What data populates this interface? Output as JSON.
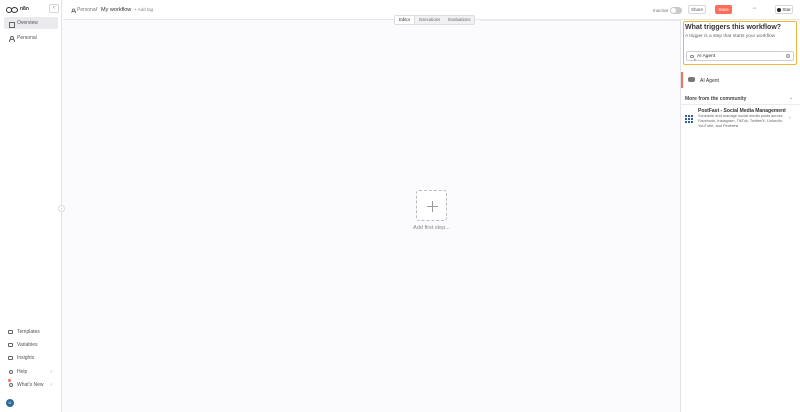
{
  "app": {
    "logo_text": "n8n"
  },
  "sidebar": {
    "overview_label": "Overview",
    "personal_label": "Personal",
    "templates_label": "Templates",
    "variables_label": "Variables",
    "insights_label": "Insights",
    "help_label": "Help",
    "whats_new_label": "What's New",
    "user_initials": "U"
  },
  "header": {
    "breadcrumb_project": "Personal",
    "breadcrumb_sep": "/",
    "workflow_title": "My workflow",
    "add_tag": "+ Add tag",
    "inactive_label": "Inactive",
    "share_label": "Share",
    "save_label": "Save",
    "more_label": "···",
    "star_label": "Star"
  },
  "tabs": [
    "Editor",
    "Executions",
    "Evaluations"
  ],
  "canvas": {
    "add_first_step": "Add first step..."
  },
  "panel": {
    "title": "What triggers this workflow?",
    "subtitle": "A trigger is a step that starts your workflow",
    "search_value": "AI Agent",
    "search_clear": "×",
    "result_label": "AI Agent",
    "community_title": "More from the community",
    "template_title": "PostFast - Social Media Management",
    "template_desc": "Schedule and manage social media posts across Facebook, Instagram, TikTok, Twitter/X, LinkedIn, YouTube, and Pinterest"
  },
  "colors": {
    "accent": "#ff6d5a",
    "highlight_border": "#f0b63c",
    "template_icon": "#2c5aa0"
  }
}
